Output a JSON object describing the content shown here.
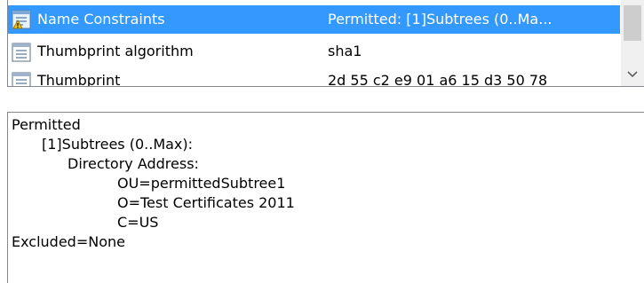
{
  "field_list": {
    "rows": [
      {
        "field": "Name Constraints",
        "value": "Permitted: [1]Subtrees (0..Ma...",
        "icon": "extension-warning-icon",
        "selected": true
      },
      {
        "field": "Thumbprint algorithm",
        "value": "sha1",
        "icon": "property-document-icon",
        "selected": false
      },
      {
        "field": "Thumbprint",
        "value": "2d 55 c2 e9 01 a6 15 d3 50 78",
        "icon": "property-document-icon",
        "selected": false
      }
    ],
    "scrollbar_icon": "chevron-down-icon"
  },
  "detail": {
    "lines": [
      "Permitted",
      "[1]Subtrees (0..Max):",
      "Directory Address:",
      "OU=permittedSubtree1",
      "O=Test Certificates 2011",
      "C=US",
      "Excluded=None"
    ]
  },
  "colors": {
    "selection": "#3399ff",
    "border": "#828790",
    "scrollbar_track": "#f0f0f0",
    "scrollbar_thumb": "#cdcdcd"
  }
}
